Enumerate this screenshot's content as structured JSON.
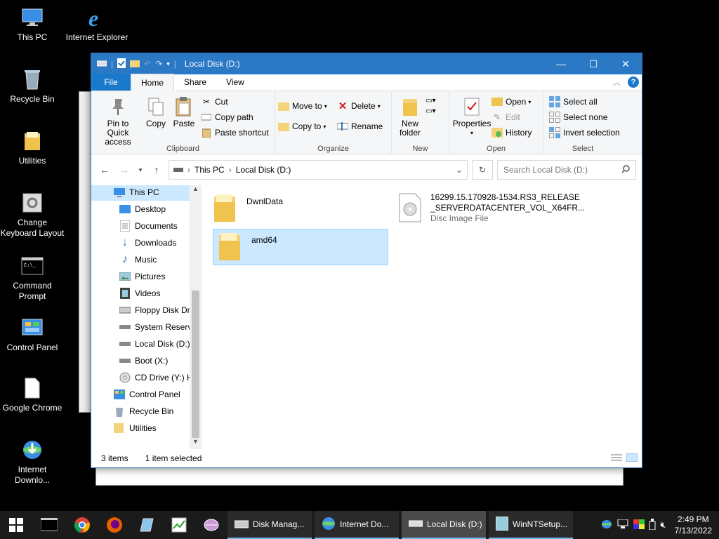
{
  "desktop": {
    "icons": [
      {
        "label": "This PC"
      },
      {
        "label": "Internet Explorer"
      },
      {
        "label": "Recycle Bin"
      },
      {
        "label": "Utilities"
      },
      {
        "label": "Change Keyboard Layout"
      },
      {
        "label": "Command Prompt"
      },
      {
        "label": "Control Panel"
      },
      {
        "label": "Google Chrome"
      },
      {
        "label": "Internet Downlo..."
      }
    ]
  },
  "window": {
    "title": "Local Disk (D:)",
    "tabs": [
      "File",
      "Home",
      "Share",
      "View"
    ],
    "clipboard": {
      "pin": "Pin to Quick access",
      "copy": "Copy",
      "paste": "Paste",
      "cut": "Cut",
      "copy_path": "Copy path",
      "paste_shortcut": "Paste shortcut",
      "label": "Clipboard"
    },
    "organize": {
      "move_to": "Move to",
      "copy_to": "Copy to",
      "delete": "Delete",
      "rename": "Rename",
      "label": "Organize"
    },
    "new": {
      "new_folder": "New folder",
      "label": "New"
    },
    "open": {
      "properties": "Properties",
      "open": "Open",
      "edit": "Edit",
      "history": "History",
      "label": "Open"
    },
    "select": {
      "select_all": "Select all",
      "select_none": "Select none",
      "invert": "Invert selection",
      "label": "Select"
    },
    "address": {
      "this_pc": "This PC",
      "drive": "Local Disk (D:)"
    },
    "search_placeholder": "Search Local Disk (D:)",
    "nav": [
      {
        "label": "This PC"
      },
      {
        "label": "Desktop"
      },
      {
        "label": "Documents"
      },
      {
        "label": "Downloads"
      },
      {
        "label": "Music"
      },
      {
        "label": "Pictures"
      },
      {
        "label": "Videos"
      },
      {
        "label": "Floppy Disk Dri"
      },
      {
        "label": "System Reserve"
      },
      {
        "label": "Local Disk (D:)"
      },
      {
        "label": "Boot (X:)"
      },
      {
        "label": "CD Drive (Y:) H"
      },
      {
        "label": "Control Panel"
      },
      {
        "label": "Recycle Bin"
      },
      {
        "label": "Utilities"
      }
    ],
    "files": [
      {
        "name": "DwnlData"
      },
      {
        "name": "amd64"
      },
      {
        "name1": "16299.15.170928-1534.RS3_RELEASE",
        "name2": "_SERVERDATACENTER_VOL_X64FR...",
        "type": "Disc Image File"
      }
    ],
    "status": {
      "count": "3 items",
      "selected": "1 item selected"
    }
  },
  "taskbar": {
    "buttons": [
      {
        "label": "Disk Manag..."
      },
      {
        "label": "Internet Do..."
      },
      {
        "label": "Local Disk (D:)"
      },
      {
        "label": "WinNTSetup..."
      }
    ],
    "time": "2:49 PM",
    "date": "7/13/2022"
  }
}
